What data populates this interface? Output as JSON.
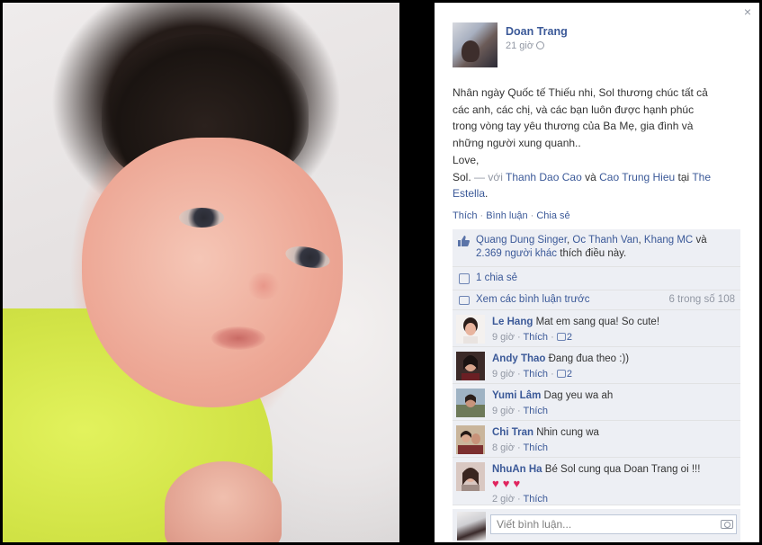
{
  "post": {
    "author": "Doan Trang",
    "time": "21 giờ",
    "text_lines": [
      "Nhân ngày Quốc tế Thiếu nhi, Sol thương chúc tất cả",
      "các anh, các chị, và các bạn luôn được hạnh phúc",
      "trong vòng tay yêu thương của Ba Mẹ, gia đình và",
      "những người xung quanh..",
      "Love,"
    ],
    "signature": "Sol.",
    "with_label": "— với",
    "tagged_1": "Thanh Dao Cao",
    "and_label": "và",
    "tagged_2": "Cao Trung Hieu",
    "at_label": "tại",
    "place_1": "The",
    "place_2": "Estella",
    "period": "."
  },
  "actions": {
    "like": "Thích",
    "comment": "Bình luận",
    "share": "Chia sẻ",
    "separator": "·"
  },
  "likes": {
    "name_1": "Quang Dung Singer",
    "name_2": "Oc Thanh Van",
    "name_3": "Khang MC",
    "and": "và",
    "others": "2.369 người khác",
    "suffix": "thích điều này."
  },
  "shares": {
    "label": "1 chia sẻ"
  },
  "previous": {
    "label": "Xem các bình luận trước",
    "count": "6 trong số 108"
  },
  "comments": [
    {
      "name": "Le Hang",
      "text": "Mat em sang qua! So cute!",
      "time": "9 giờ",
      "like": "Thích",
      "likes": "2"
    },
    {
      "name": "Andy Thao",
      "text": "Đang đua theo :))",
      "time": "9 giờ",
      "like": "Thích",
      "likes": "2"
    },
    {
      "name": "Yumi Lâm",
      "text": "Dag yeu wa ah",
      "time": "9 giờ",
      "like": "Thích",
      "likes": ""
    },
    {
      "name": "Chi Tran",
      "text": "Nhin cung wa",
      "time": "8 giờ",
      "like": "Thích",
      "likes": ""
    },
    {
      "name": "NhuAn Ha",
      "text": "Bé Sol cung qua Doan Trang oi !!!",
      "hearts": "♥♥♥",
      "time": "2 giờ",
      "like": "Thích",
      "likes": ""
    }
  ],
  "compose": {
    "placeholder": "Viết bình luận..."
  },
  "close_symbol": "×",
  "meta_dot": " · "
}
